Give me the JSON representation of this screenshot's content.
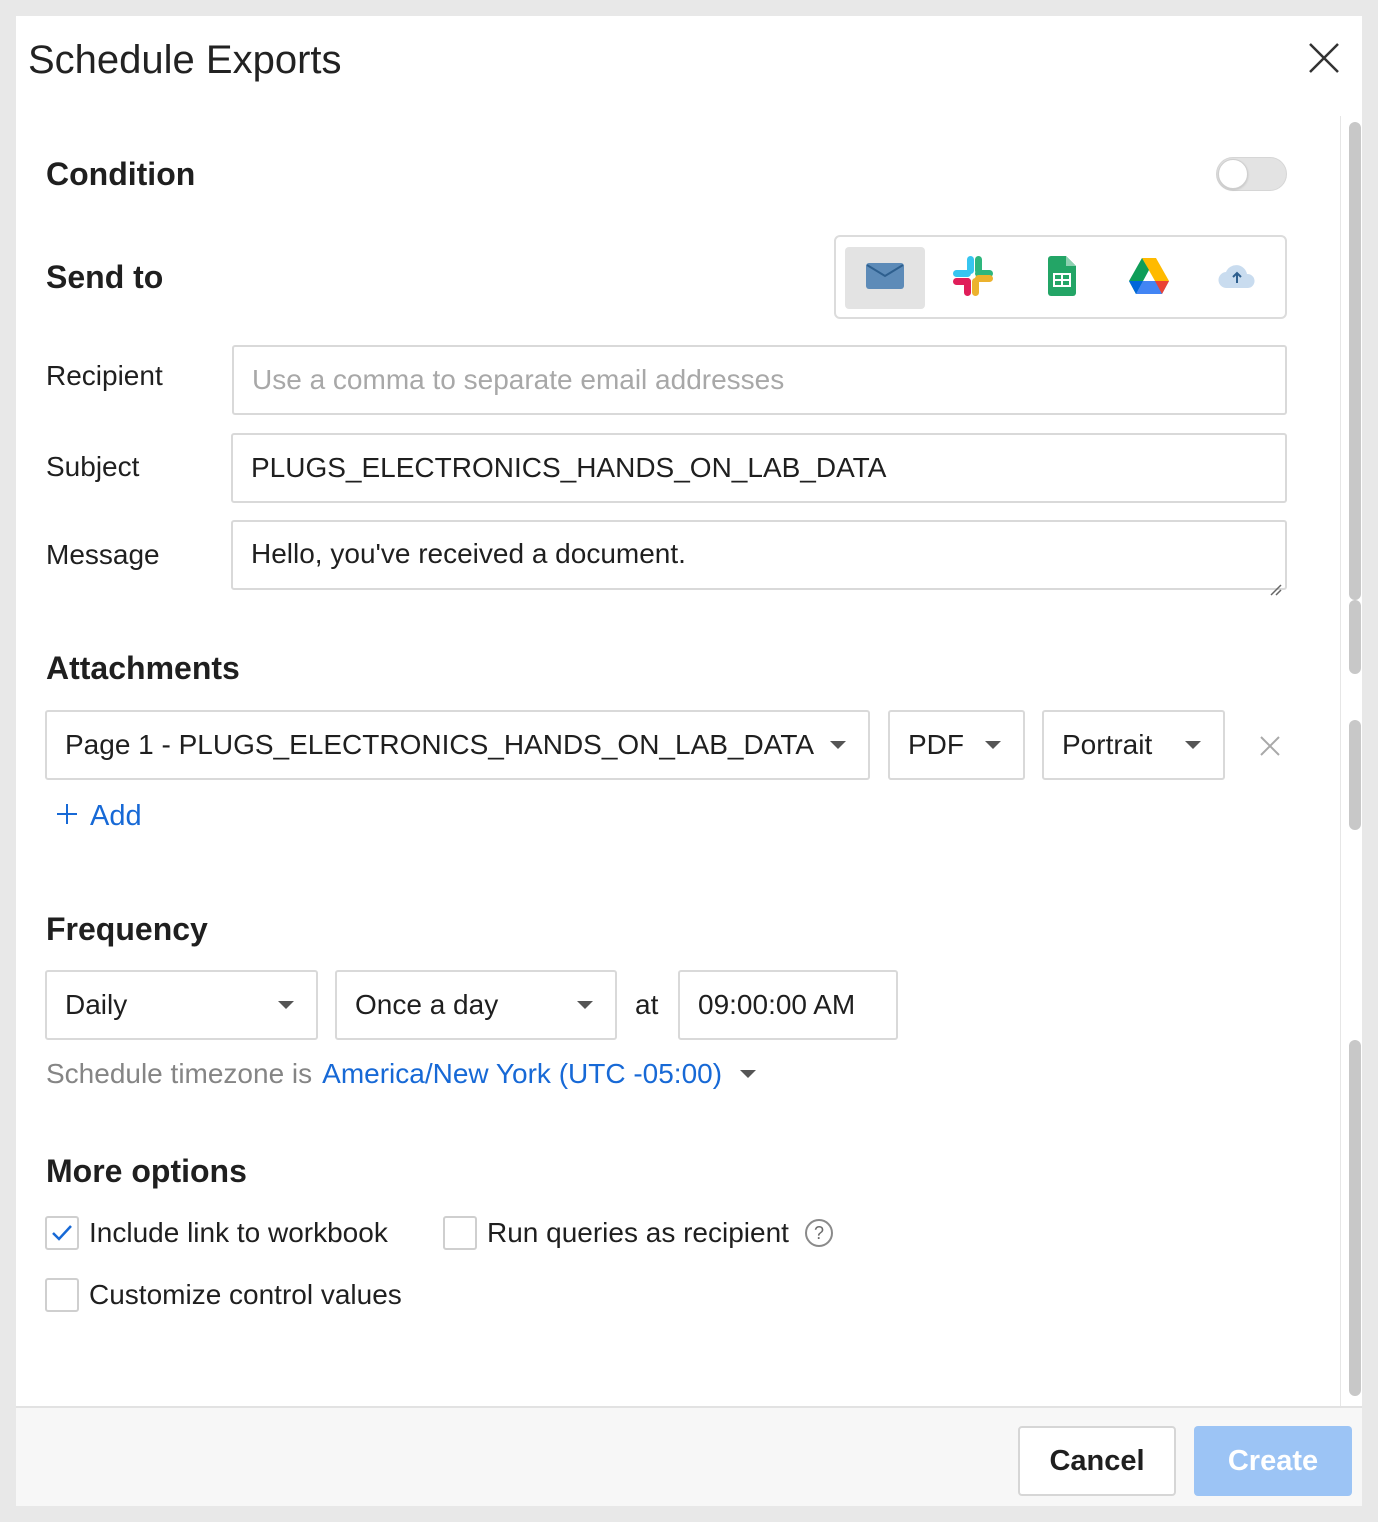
{
  "dialog": {
    "title": "Schedule Exports"
  },
  "condition": {
    "label": "Condition",
    "enabled": false
  },
  "send_to": {
    "label": "Send to",
    "destinations": [
      {
        "icon": "email-icon",
        "active": true
      },
      {
        "icon": "slack-icon",
        "active": false
      },
      {
        "icon": "google-sheets-icon",
        "active": false
      },
      {
        "icon": "google-drive-icon",
        "active": false
      },
      {
        "icon": "cloud-upload-icon",
        "active": false
      }
    ]
  },
  "form": {
    "recipient_label": "Recipient",
    "recipient_placeholder": "Use a comma to separate email addresses",
    "recipient_value": "",
    "subject_label": "Subject",
    "subject_value": "PLUGS_ELECTRONICS_HANDS_ON_LAB_DATA",
    "message_label": "Message",
    "message_value": "Hello, you've received a document."
  },
  "attachments": {
    "label": "Attachments",
    "items": [
      {
        "page": "Page 1 - PLUGS_ELECTRONICS_HANDS_ON_LAB_DATA",
        "format": "PDF",
        "orientation": "Portrait"
      }
    ],
    "add_label": "Add"
  },
  "frequency": {
    "label": "Frequency",
    "period": "Daily",
    "times": "Once a day",
    "at_label": "at",
    "time": "09:00:00 AM",
    "timezone_prefix": "Schedule timezone is",
    "timezone": "America/New York (UTC -05:00)"
  },
  "more_options": {
    "label": "More options",
    "include_link": {
      "label": "Include link to workbook",
      "checked": true
    },
    "run_queries": {
      "label": "Run queries as recipient",
      "checked": false,
      "help": "?"
    },
    "customize_controls": {
      "label": "Customize control values",
      "checked": false
    }
  },
  "footer": {
    "cancel_label": "Cancel",
    "create_label": "Create"
  },
  "colors": {
    "accent": "#1769d6",
    "create_disabled": "#9cc4f5"
  }
}
